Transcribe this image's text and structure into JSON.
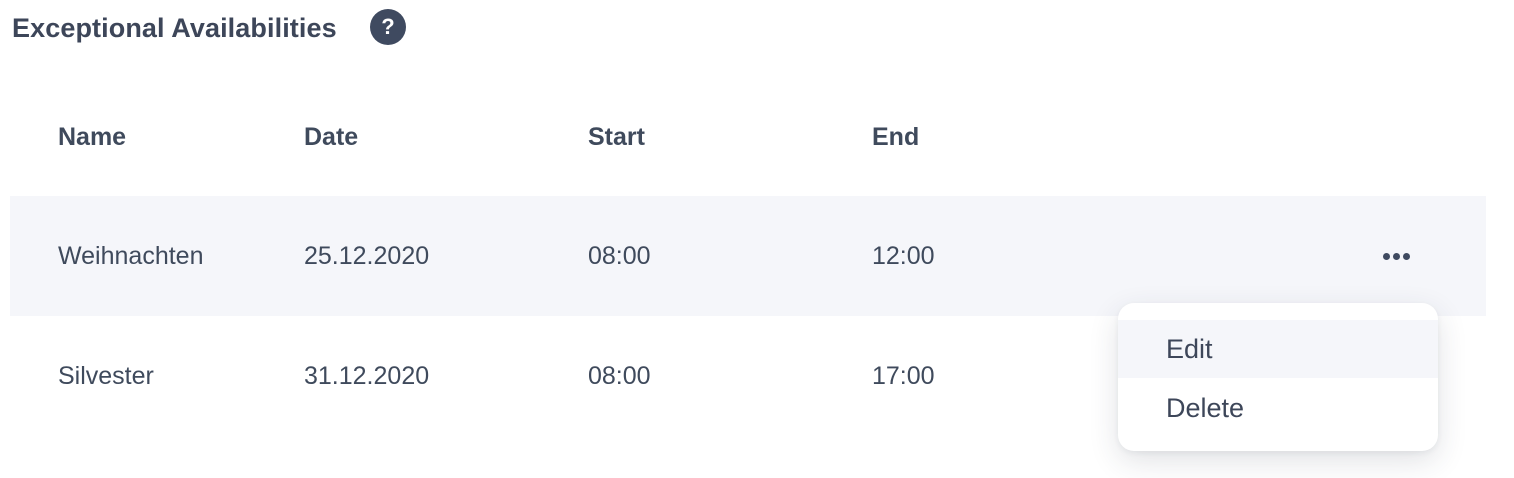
{
  "section": {
    "title": "Exceptional Availabilities",
    "help_icon": "question-mark-icon",
    "help_glyph": "?"
  },
  "table": {
    "columns": [
      "Name",
      "Date",
      "Start",
      "End"
    ],
    "rows": [
      {
        "name": "Weihnachten",
        "date": "25.12.2020",
        "start": "08:00",
        "end": "12:00"
      },
      {
        "name": "Silvester",
        "date": "31.12.2020",
        "start": "08:00",
        "end": "17:00"
      }
    ],
    "row_actions_icon": "more-horizontal-icon"
  },
  "context_menu": {
    "items": [
      "Edit",
      "Delete"
    ]
  },
  "colors": {
    "text": "#3d4659",
    "row_highlight": "#f5f6fa",
    "icon": "#3f4a60"
  }
}
